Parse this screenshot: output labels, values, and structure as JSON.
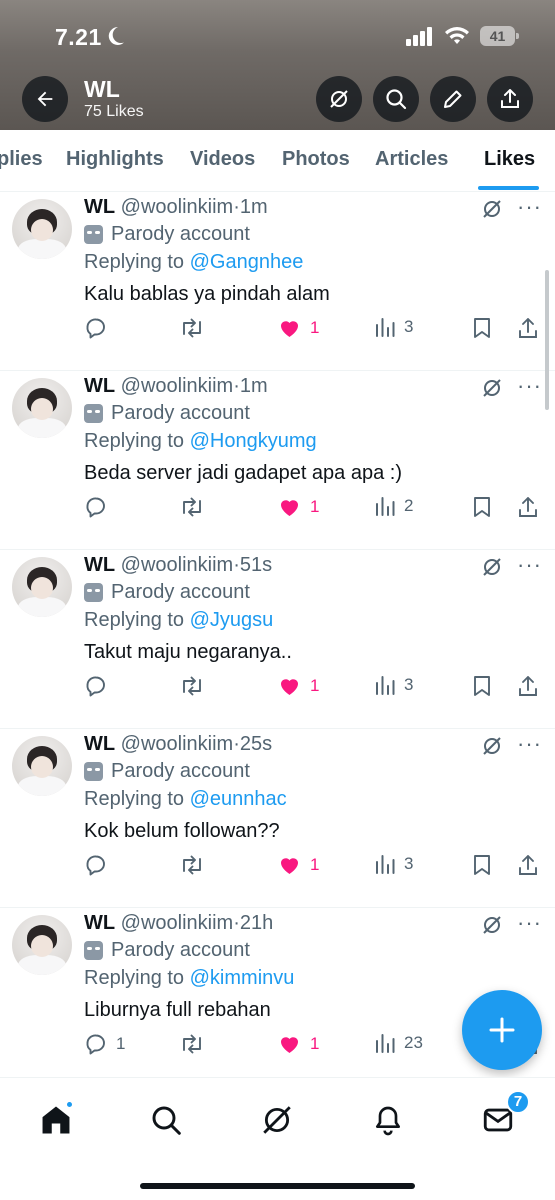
{
  "status": {
    "time": "7.21",
    "battery": "41",
    "icons": [
      "moon-icon",
      "signal-icon",
      "wifi-icon",
      "battery-icon"
    ]
  },
  "header": {
    "title": "WL",
    "subtitle": "75 Likes",
    "buttons": [
      "back-arrow-icon",
      "grok-icon",
      "search-icon",
      "edit-icon",
      "share-icon"
    ]
  },
  "tabs": [
    {
      "label": "plies"
    },
    {
      "label": "Highlights"
    },
    {
      "label": "Videos"
    },
    {
      "label": "Photos"
    },
    {
      "label": "Articles"
    },
    {
      "label": "Likes"
    }
  ],
  "active_tab": "Likes",
  "tweets": [
    {
      "name": "WL",
      "handle": "@woolinkiim",
      "sep": "·",
      "time": "1m",
      "parody": "Parody account",
      "reply_prefix": "Replying to",
      "reply_to": "@Gangnhee",
      "text": "Kalu bablas ya pindah alam",
      "replies": "",
      "likes": "1",
      "views": "3"
    },
    {
      "name": "WL",
      "handle": "@woolinkiim",
      "sep": "·",
      "time": "1m",
      "parody": "Parody account",
      "reply_prefix": "Replying to",
      "reply_to": "@Hongkyumg",
      "text": "Beda server jadi gadapet apa apa :)",
      "replies": "",
      "likes": "1",
      "views": "2"
    },
    {
      "name": "WL",
      "handle": "@woolinkiim",
      "sep": "·",
      "time": "51s",
      "parody": "Parody account",
      "reply_prefix": "Replying to",
      "reply_to": "@Jyugsu",
      "text": "Takut maju negaranya..",
      "replies": "",
      "likes": "1",
      "views": "3"
    },
    {
      "name": "WL",
      "handle": "@woolinkiim",
      "sep": "·",
      "time": "25s",
      "parody": "Parody account",
      "reply_prefix": "Replying to",
      "reply_to": "@eunnhac",
      "text": "Kok belum followan??",
      "replies": "",
      "likes": "1",
      "views": "3"
    },
    {
      "name": "WL",
      "handle": "@woolinkiim",
      "sep": "·",
      "time": "21h",
      "parody": "Parody account",
      "reply_prefix": "Replying to",
      "reply_to": "@kimminvu",
      "text": "Liburnya full rebahan",
      "replies": "1",
      "likes": "1",
      "views": "23"
    }
  ],
  "fab": {
    "icon": "compose-plus-icon"
  },
  "bottom_nav": {
    "items": [
      "home-icon",
      "search-icon",
      "grok-icon",
      "notifications-icon",
      "messages-icon"
    ],
    "messages_badge": "7"
  },
  "colors": {
    "accent": "#1d9bf0",
    "like": "#f91880",
    "secondary_text": "#536471",
    "primary_text": "#0f1419"
  }
}
